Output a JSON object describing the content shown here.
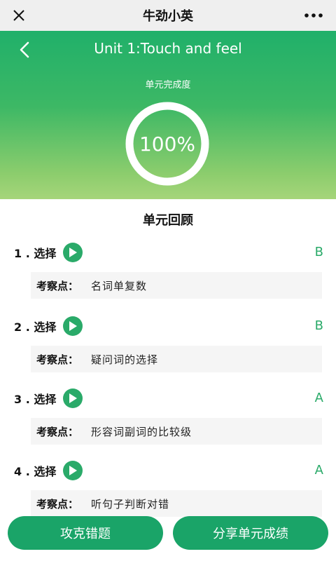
{
  "app": {
    "title": "牛劲小英"
  },
  "hero": {
    "unit_title": "Unit 1:Touch and feel",
    "completion_label": "单元完成度",
    "completion_percent_text": "100%",
    "completion_fraction": 1.0
  },
  "review": {
    "title": "单元回顾",
    "point_label": "考察点：",
    "questions": [
      {
        "num": "1 . 选择",
        "answer": "B",
        "point": "名词单复数"
      },
      {
        "num": "2 . 选择",
        "answer": "B",
        "point": "疑问词的选择"
      },
      {
        "num": "3 . 选择",
        "answer": "A",
        "point": "形容词副词的比较级"
      },
      {
        "num": "4 . 选择",
        "answer": "A",
        "point": "听句子判断对错"
      }
    ]
  },
  "buttons": {
    "left": "攻克错题",
    "right": "分享单元成绩"
  },
  "colors": {
    "accent": "#2aaa69",
    "button": "#1aa468",
    "hero_top": "#20b06a",
    "hero_bottom": "#a6d57a"
  },
  "icons": {
    "close": "close-icon",
    "more": "more-icon",
    "back": "back-arrow-icon",
    "play": "play-icon"
  }
}
